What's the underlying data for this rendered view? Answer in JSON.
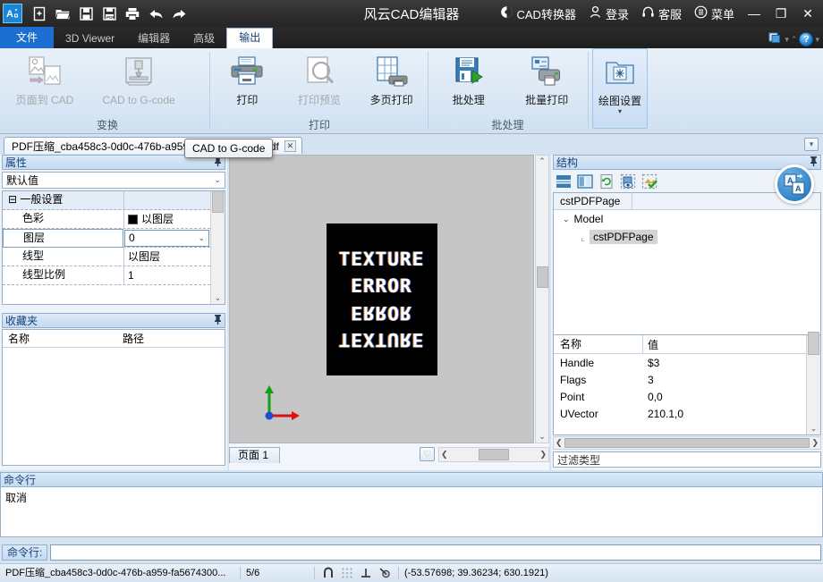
{
  "titlebar": {
    "app_title": "风云CAD编辑器",
    "quick_icons": [
      {
        "name": "new-icon",
        "label": "新建"
      },
      {
        "name": "open-folder-icon",
        "label": "打开"
      },
      {
        "name": "save-icon",
        "label": "保存"
      },
      {
        "name": "save-pdf-icon",
        "label": "另存为PDF"
      },
      {
        "name": "print-icon",
        "label": "打印"
      },
      {
        "name": "undo-icon",
        "label": "撤销"
      },
      {
        "name": "redo-icon",
        "label": "重做"
      }
    ],
    "right_items": [
      {
        "name": "cad-converter",
        "label": "CAD转换器",
        "icon": "converter-icon"
      },
      {
        "name": "login",
        "label": "登录",
        "icon": "user-icon"
      },
      {
        "name": "support",
        "label": "客服",
        "icon": "headset-icon"
      },
      {
        "name": "menu",
        "label": "菜单",
        "icon": "list-menu-icon"
      }
    ],
    "window_buttons": {
      "minimize": "—",
      "maximize": "❐",
      "close": "✕"
    }
  },
  "tabs": [
    {
      "label": "文件",
      "state": "file"
    },
    {
      "label": "3D Viewer",
      "state": "normal"
    },
    {
      "label": "编辑器",
      "state": "normal"
    },
    {
      "label": "高级",
      "state": "normal"
    },
    {
      "label": "输出",
      "state": "active"
    }
  ],
  "tabbar_right": {
    "help_label": "?",
    "collapse": "⌃",
    "dropdown": "▾"
  },
  "ribbon": {
    "groups": [
      {
        "title": "变换",
        "buttons": [
          {
            "label": "页面到 CAD",
            "name": "page-to-cad-button",
            "disabled": true,
            "icon": "page-to-cad-icon"
          },
          {
            "label": "CAD to G-code",
            "name": "cad-to-gcode-button",
            "disabled": true,
            "icon": "gcode-machine-icon"
          }
        ]
      },
      {
        "title": "打印",
        "buttons": [
          {
            "label": "打印",
            "name": "print-button",
            "disabled": false,
            "icon": "printer-icon"
          },
          {
            "label": "打印预览",
            "name": "print-preview-button",
            "disabled": true,
            "icon": "preview-magnifier-icon"
          },
          {
            "label": "多页打印",
            "name": "multipage-print-button",
            "disabled": false,
            "icon": "multipage-print-icon"
          }
        ]
      },
      {
        "title": "批处理",
        "buttons": [
          {
            "label": "批处理",
            "name": "batch-process-button",
            "disabled": false,
            "icon": "batch-icon"
          },
          {
            "label": "批量打印",
            "name": "batch-print-button",
            "disabled": false,
            "icon": "batch-print-icon"
          }
        ]
      },
      {
        "title": "",
        "buttons": [
          {
            "label": "绘图设置",
            "name": "plot-settings-button",
            "disabled": false,
            "icon": "plot-settings-icon",
            "selected": true,
            "split": "▾"
          }
        ]
      }
    ],
    "tooltip": "CAD to G-code"
  },
  "document_tab": {
    "filename": "PDF压缩_cba458c3-0d0c-476b-a959-fa5674300741.pdf",
    "close": "✕",
    "right_button": "▾"
  },
  "properties_panel": {
    "title": "属性",
    "pin": "📌",
    "selector_value": "默认值",
    "selector_arrow": "⌄",
    "rows": [
      {
        "name": "一般设置",
        "value": "",
        "type": "category",
        "expander": "⊟"
      },
      {
        "name": "色彩",
        "value": "以图层",
        "type": "color",
        "selected": false
      },
      {
        "name": "图层",
        "value": "0",
        "type": "combo",
        "selected": true
      },
      {
        "name": "线型",
        "value": "以图层",
        "type": "text",
        "selected": false
      },
      {
        "name": "线型比例",
        "value": "1",
        "type": "text",
        "selected": false
      }
    ]
  },
  "favorites_panel": {
    "title": "收藏夹",
    "pin": "📌",
    "columns": [
      "名称",
      "路径"
    ],
    "rows": []
  },
  "canvas": {
    "texture_lines": [
      "TEXTURE",
      "ERROR",
      "ERROR",
      "TEXTURE"
    ],
    "page_tab": "页面 1",
    "heart_icon": "♡",
    "scroll_left": "❮",
    "scroll_right": "❯",
    "scroll_up": "⌃",
    "scroll_down": "⌄"
  },
  "structure_panel": {
    "title": "结构",
    "pin": "📌",
    "toolbar_icons": [
      "rows-layout-icon",
      "columns-layout-icon",
      "refresh-page-icon",
      "preview-select-icon",
      "apply-check-icon"
    ],
    "badge_icon": "translate-icon",
    "column_header": "cstPDFPage",
    "tree": [
      {
        "label": "Model",
        "level": 0,
        "expander": "⌄"
      },
      {
        "label": "cstPDFPage",
        "level": 1,
        "selected": true
      }
    ]
  },
  "values_panel": {
    "columns": [
      "名称",
      "值"
    ],
    "rows": [
      {
        "name": "Handle",
        "value": "$3"
      },
      {
        "name": "Flags",
        "value": "3"
      },
      {
        "name": "Point",
        "value": "0,0"
      },
      {
        "name": "UVector",
        "value": "210.1,0"
      }
    ],
    "filter_placeholder": "过滤类型",
    "scroll_left": "❮",
    "scroll_right": "❯",
    "scroll_up": "⌃",
    "scroll_down": "⌄"
  },
  "command_panel": {
    "title": "命令行",
    "history": "取消",
    "prompt_label": "命令行:",
    "input_value": ""
  },
  "statusbar": {
    "filename": "PDF压缩_cba458c3-0d0c-476b-a959-fa5674300...",
    "page": "5/6",
    "icons": [
      "snap-icon",
      "grid-icon",
      "ortho-icon",
      "polar-icon"
    ],
    "coordinates": "(-53.57698; 39.36234; 630.1921)"
  },
  "colors": {
    "accent": "#1c6fd0",
    "titlebar": "#2e2e2e",
    "ribbon": "#dce8f5",
    "panel_title": "#16417a",
    "canvas_bg": "#c6c6c6"
  }
}
